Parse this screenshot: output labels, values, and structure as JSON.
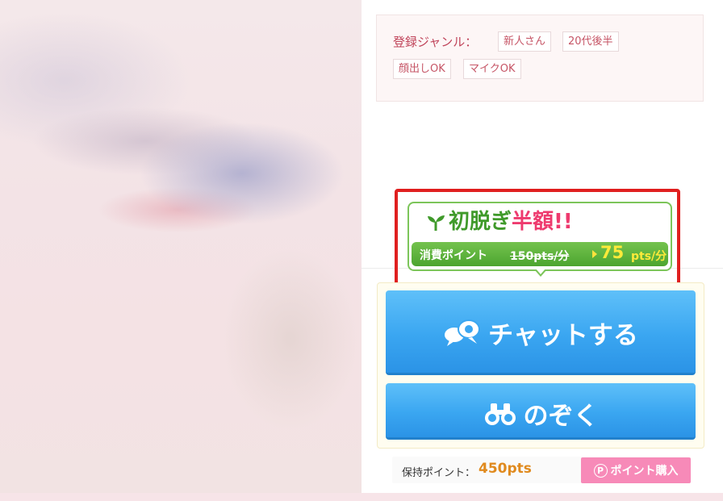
{
  "genre": {
    "label": "登録ジャンル：",
    "tags": [
      "新人さん",
      "20代後半",
      "顔出しOK",
      "マイクOK"
    ]
  },
  "promo": {
    "title_green": "初脱ぎ",
    "title_pink": "半額!!",
    "consume_label": "消費ポイント",
    "old_price": "150pts/分",
    "new_price": "75",
    "new_unit": "pts/分",
    "icon": "sprout-icon"
  },
  "actions": {
    "chat_label": "チャットする",
    "chat_icon": "chat-bubbles-icon",
    "peek_label": "のぞく",
    "peek_icon": "binoculars-icon"
  },
  "points": {
    "label": "保持ポイント：",
    "value": "450pts",
    "buy_label": "ポイント購入",
    "buy_icon_glyph": "P"
  },
  "colors": {
    "accent_blue": "#3aa6f1",
    "promo_green": "#4ca52f",
    "promo_pink": "#ee3a6e",
    "highlight_red": "#e01f1f",
    "points_orange": "#e08a1e",
    "buy_pink": "#f78ab8"
  }
}
